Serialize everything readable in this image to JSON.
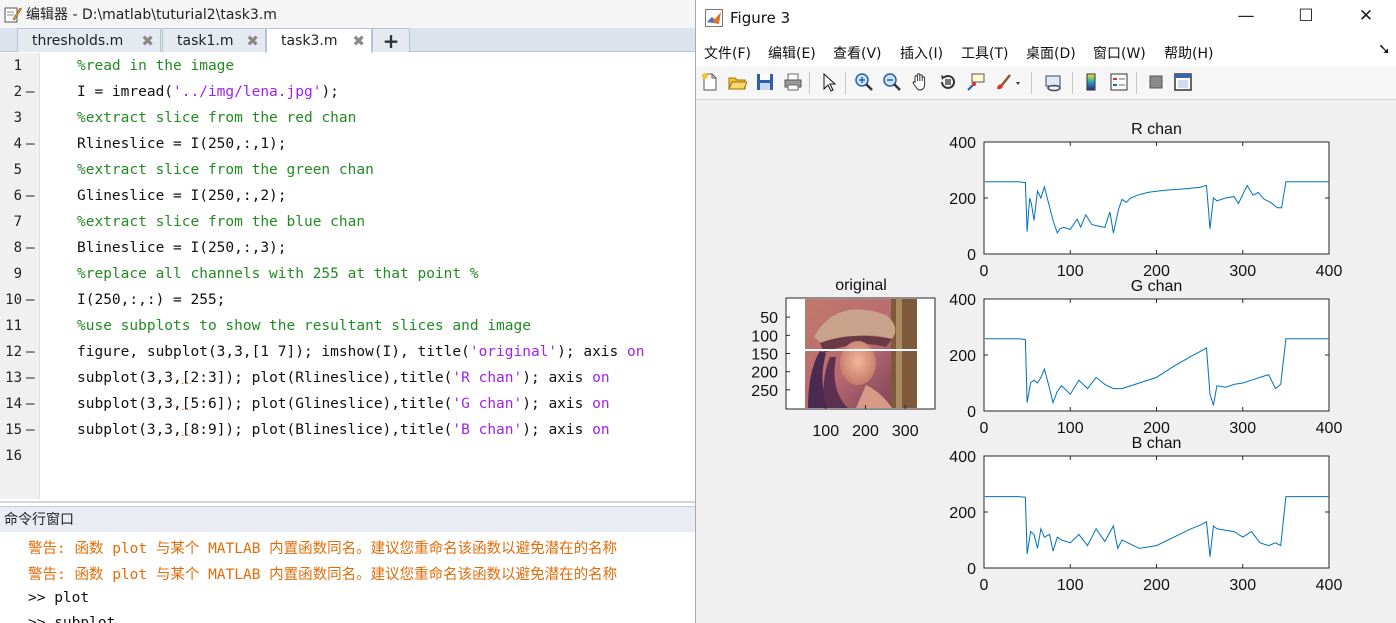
{
  "editor": {
    "title": "编辑器 - D:\\matlab\\tuturial2\\task3.m",
    "tabs": [
      {
        "label": "thresholds.m",
        "active": false
      },
      {
        "label": "task1.m",
        "active": false
      },
      {
        "label": "task3.m",
        "active": true
      }
    ],
    "add_tab_label": "+",
    "code_lines": [
      {
        "num": "1",
        "dash": "",
        "parts": [
          {
            "t": "%read in the image",
            "c": "cm"
          }
        ]
      },
      {
        "num": "2",
        "dash": "—",
        "parts": [
          {
            "t": "I = imread(",
            "c": "pl"
          },
          {
            "t": "'../img/lena.jpg'",
            "c": "st"
          },
          {
            "t": ");",
            "c": "pl"
          }
        ]
      },
      {
        "num": "3",
        "dash": "",
        "parts": [
          {
            "t": "%extract slice from the red chan",
            "c": "cm"
          }
        ]
      },
      {
        "num": "4",
        "dash": "—",
        "parts": [
          {
            "t": "Rlineslice = I(250,:,1);",
            "c": "pl"
          }
        ]
      },
      {
        "num": "5",
        "dash": "",
        "parts": [
          {
            "t": "%extract slice from the green chan",
            "c": "cm"
          }
        ]
      },
      {
        "num": "6",
        "dash": "—",
        "parts": [
          {
            "t": "Glineslice = I(250,:,2);",
            "c": "pl"
          }
        ]
      },
      {
        "num": "7",
        "dash": "",
        "parts": [
          {
            "t": "%extract slice from the blue chan",
            "c": "cm"
          }
        ]
      },
      {
        "num": "8",
        "dash": "—",
        "parts": [
          {
            "t": "Blineslice = I(250,:,3);",
            "c": "pl"
          }
        ]
      },
      {
        "num": "9",
        "dash": "",
        "parts": [
          {
            "t": "%replace all channels with 255 at that point %",
            "c": "cm"
          }
        ]
      },
      {
        "num": "10",
        "dash": "—",
        "parts": [
          {
            "t": "I(250,:,:) = 255;",
            "c": "pl"
          }
        ]
      },
      {
        "num": "11",
        "dash": "",
        "parts": [
          {
            "t": "%use subplots to show the resultant slices and image",
            "c": "cm"
          }
        ]
      },
      {
        "num": "12",
        "dash": "—",
        "parts": [
          {
            "t": "figure, subplot(3,3,[1 7]); imshow(I), title(",
            "c": "pl"
          },
          {
            "t": "'original'",
            "c": "st"
          },
          {
            "t": "); axis ",
            "c": "pl"
          },
          {
            "t": "on",
            "c": "kw"
          }
        ]
      },
      {
        "num": "13",
        "dash": "—",
        "parts": [
          {
            "t": "subplot(3,3,",
            "c": "pl"
          },
          {
            "t": "[",
            "c": "pl ul"
          },
          {
            "t": "2:3]); plot(Rlineslice),title(",
            "c": "pl"
          },
          {
            "t": "'R chan'",
            "c": "st"
          },
          {
            "t": "); axis ",
            "c": "pl"
          },
          {
            "t": "on",
            "c": "kw"
          }
        ]
      },
      {
        "num": "14",
        "dash": "—",
        "parts": [
          {
            "t": "subplot(3,3,",
            "c": "pl"
          },
          {
            "t": "[",
            "c": "pl ul"
          },
          {
            "t": "5:6]); plot(Glineslice),title(",
            "c": "pl"
          },
          {
            "t": "'G chan'",
            "c": "st"
          },
          {
            "t": "); axis ",
            "c": "pl"
          },
          {
            "t": "on",
            "c": "kw"
          }
        ]
      },
      {
        "num": "15",
        "dash": "—",
        "parts": [
          {
            "t": "subplot(3,3,",
            "c": "pl"
          },
          {
            "t": "[",
            "c": "pl ul"
          },
          {
            "t": "8:9]); plot(Blineslice),title(",
            "c": "pl"
          },
          {
            "t": "'B chan'",
            "c": "st"
          },
          {
            "t": "); axis ",
            "c": "pl"
          },
          {
            "t": "on",
            "c": "kw"
          }
        ]
      },
      {
        "num": "16",
        "dash": "",
        "parts": []
      }
    ]
  },
  "command_window": {
    "title": "命令行窗口",
    "warnings": [
      "警告: 函数 plot 与某个 MATLAB 内置函数同名。建议您重命名该函数以避免潜在的名称",
      "警告: 函数 plot 与某个 MATLAB 内置函数同名。建议您重命名该函数以避免潜在的名称"
    ],
    "prompts": [
      ">> plot",
      ">> subplot"
    ]
  },
  "figure": {
    "title": "Figure 3",
    "controls": {
      "minimize": "—",
      "maximize": "☐",
      "close": "✕"
    },
    "menu": [
      "文件(F)",
      "编辑(E)",
      "查看(V)",
      "插入(I)",
      "工具(T)",
      "桌面(D)",
      "窗口(W)",
      "帮助(H)"
    ],
    "menu_arrow": "➘",
    "toolbar_icons": [
      "new-figure-icon",
      "open-file-icon",
      "save-icon",
      "print-icon",
      "pointer-icon",
      "zoom-in-icon",
      "zoom-out-icon",
      "pan-hand-icon",
      "rotate-3d-icon",
      "data-cursor-icon",
      "brush-icon",
      "link-plot-icon",
      "colorbar-icon",
      "legend-icon",
      "hide-plot-tools-icon",
      "show-plot-tools-icon"
    ]
  },
  "chart_data": [
    {
      "type": "image",
      "title": "original",
      "yticks": [
        50,
        100,
        150,
        200,
        250
      ],
      "xticks": [
        100,
        200,
        300
      ]
    },
    {
      "type": "line",
      "title": "R chan",
      "xlim": [
        0,
        400
      ],
      "ylim": [
        0,
        400
      ],
      "xticks": [
        0,
        100,
        200,
        300,
        400
      ],
      "yticks": [
        0,
        200,
        400
      ],
      "color": "#0072bd",
      "x": [
        1,
        40,
        48,
        50,
        53,
        55,
        58,
        62,
        66,
        70,
        75,
        80,
        85,
        88,
        92,
        100,
        108,
        112,
        118,
        125,
        132,
        140,
        146,
        150,
        156,
        160,
        165,
        170,
        178,
        190,
        200,
        210,
        230,
        250,
        258,
        262,
        266,
        270,
        280,
        290,
        295,
        305,
        312,
        318,
        325,
        332,
        340,
        345,
        350,
        360,
        400
      ],
      "y": [
        258,
        258,
        255,
        80,
        200,
        180,
        120,
        225,
        200,
        240,
        180,
        120,
        75,
        90,
        95,
        88,
        125,
        96,
        140,
        105,
        100,
        95,
        150,
        75,
        160,
        195,
        185,
        200,
        210,
        220,
        224,
        228,
        232,
        238,
        245,
        90,
        200,
        190,
        200,
        205,
        180,
        245,
        210,
        220,
        195,
        185,
        165,
        165,
        258,
        258,
        258
      ]
    },
    {
      "type": "line",
      "title": "G chan",
      "xlim": [
        0,
        400
      ],
      "ylim": [
        0,
        400
      ],
      "xticks": [
        0,
        100,
        200,
        300,
        400
      ],
      "yticks": [
        0,
        200,
        400
      ],
      "color": "#0072bd",
      "x": [
        1,
        40,
        48,
        50,
        54,
        58,
        62,
        66,
        70,
        76,
        80,
        85,
        90,
        100,
        110,
        120,
        130,
        140,
        150,
        160,
        180,
        200,
        220,
        240,
        252,
        258,
        262,
        266,
        270,
        280,
        290,
        300,
        310,
        320,
        330,
        338,
        344,
        350,
        360,
        400
      ],
      "y": [
        258,
        258,
        255,
        30,
        100,
        110,
        100,
        120,
        150,
        80,
        30,
        70,
        90,
        60,
        110,
        80,
        120,
        95,
        80,
        80,
        100,
        120,
        160,
        195,
        215,
        225,
        60,
        20,
        90,
        85,
        95,
        100,
        110,
        120,
        130,
        80,
        95,
        258,
        258,
        258
      ]
    },
    {
      "type": "line",
      "title": "B chan",
      "xlim": [
        0,
        400
      ],
      "ylim": [
        0,
        400
      ],
      "xticks": [
        0,
        100,
        200,
        300,
        400
      ],
      "yticks": [
        0,
        200,
        400
      ],
      "color": "#0072bd",
      "x": [
        1,
        40,
        48,
        50,
        54,
        58,
        62,
        66,
        70,
        76,
        80,
        85,
        90,
        100,
        110,
        120,
        130,
        140,
        150,
        155,
        160,
        180,
        200,
        220,
        240,
        252,
        258,
        262,
        266,
        270,
        280,
        290,
        300,
        310,
        320,
        330,
        338,
        344,
        350,
        360,
        400
      ],
      "y": [
        255,
        255,
        253,
        50,
        130,
        120,
        70,
        140,
        110,
        120,
        60,
        110,
        100,
        90,
        120,
        80,
        140,
        95,
        150,
        70,
        100,
        70,
        80,
        110,
        140,
        155,
        165,
        40,
        150,
        140,
        135,
        130,
        110,
        130,
        90,
        80,
        90,
        80,
        255,
        255,
        255
      ]
    }
  ]
}
